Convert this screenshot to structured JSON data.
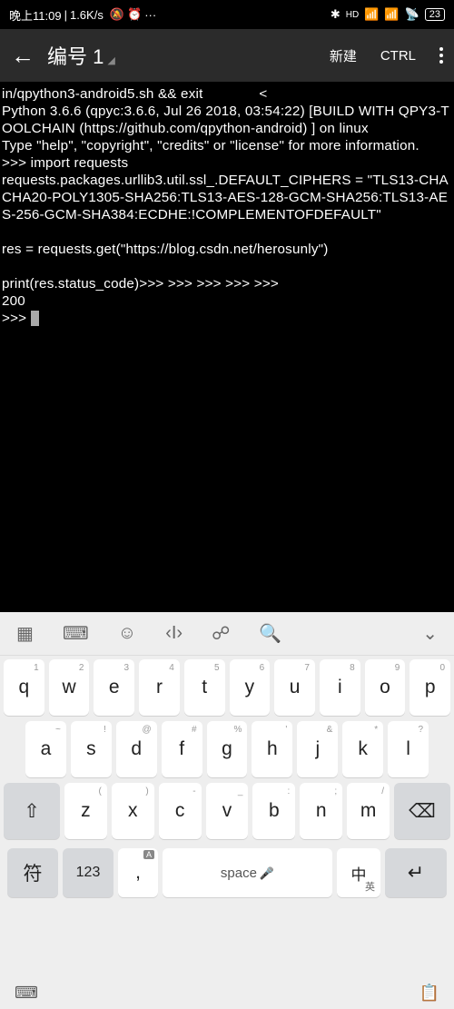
{
  "status": {
    "time": "晚上11:09",
    "speed": "1.6K/s",
    "battery": "23"
  },
  "appbar": {
    "title": "编号 1",
    "new": "新建",
    "ctrl": "CTRL"
  },
  "terminal": {
    "content": "in/qpython3-android5.sh && exit              <\nPython 3.6.6 (qpyc:3.6.6, Jul 26 2018, 03:54:22) [BUILD WITH QPY3-TOOLCHAIN (https://github.com/qpython-android) ] on linux\nType \"help\", \"copyright\", \"credits\" or \"license\" for more information.\n>>> import requests\nrequests.packages.urllib3.util.ssl_.DEFAULT_CIPHERS = \"TLS13-CHACHA20-POLY1305-SHA256:TLS13-AES-128-GCM-SHA256:TLS13-AES-256-GCM-SHA384:ECDHE:!COMPLEMENTOFDEFAULT\"\n\nres = requests.get(\"https://blog.csdn.net/herosunly\")\n\nprint(res.status_code)>>> >>> >>> >>> >>>\n200\n>>> "
  },
  "keyboard": {
    "row1": [
      {
        "main": "q",
        "sup": "1"
      },
      {
        "main": "w",
        "sup": "2"
      },
      {
        "main": "e",
        "sup": "3"
      },
      {
        "main": "r",
        "sup": "4"
      },
      {
        "main": "t",
        "sup": "5"
      },
      {
        "main": "y",
        "sup": "6"
      },
      {
        "main": "u",
        "sup": "7"
      },
      {
        "main": "i",
        "sup": "8"
      },
      {
        "main": "o",
        "sup": "9"
      },
      {
        "main": "p",
        "sup": "0"
      }
    ],
    "row2": [
      {
        "main": "a",
        "sup": "~"
      },
      {
        "main": "s",
        "sup": "!"
      },
      {
        "main": "d",
        "sup": "@"
      },
      {
        "main": "f",
        "sup": "#"
      },
      {
        "main": "g",
        "sup": "%"
      },
      {
        "main": "h",
        "sup": "'"
      },
      {
        "main": "j",
        "sup": "&"
      },
      {
        "main": "k",
        "sup": "*"
      },
      {
        "main": "l",
        "sup": "?"
      }
    ],
    "row3": [
      {
        "main": "z",
        "sup": "("
      },
      {
        "main": "x",
        "sup": ")"
      },
      {
        "main": "c",
        "sup": "-"
      },
      {
        "main": "v",
        "sup": "_"
      },
      {
        "main": "b",
        "sup": ":"
      },
      {
        "main": "n",
        "sup": ";"
      },
      {
        "main": "m",
        "sup": "/"
      }
    ],
    "row4": {
      "sym": "符",
      "num": "123",
      "comma": ",",
      "space": "space",
      "period": ".",
      "lang": "中",
      "langSub": "英"
    }
  }
}
